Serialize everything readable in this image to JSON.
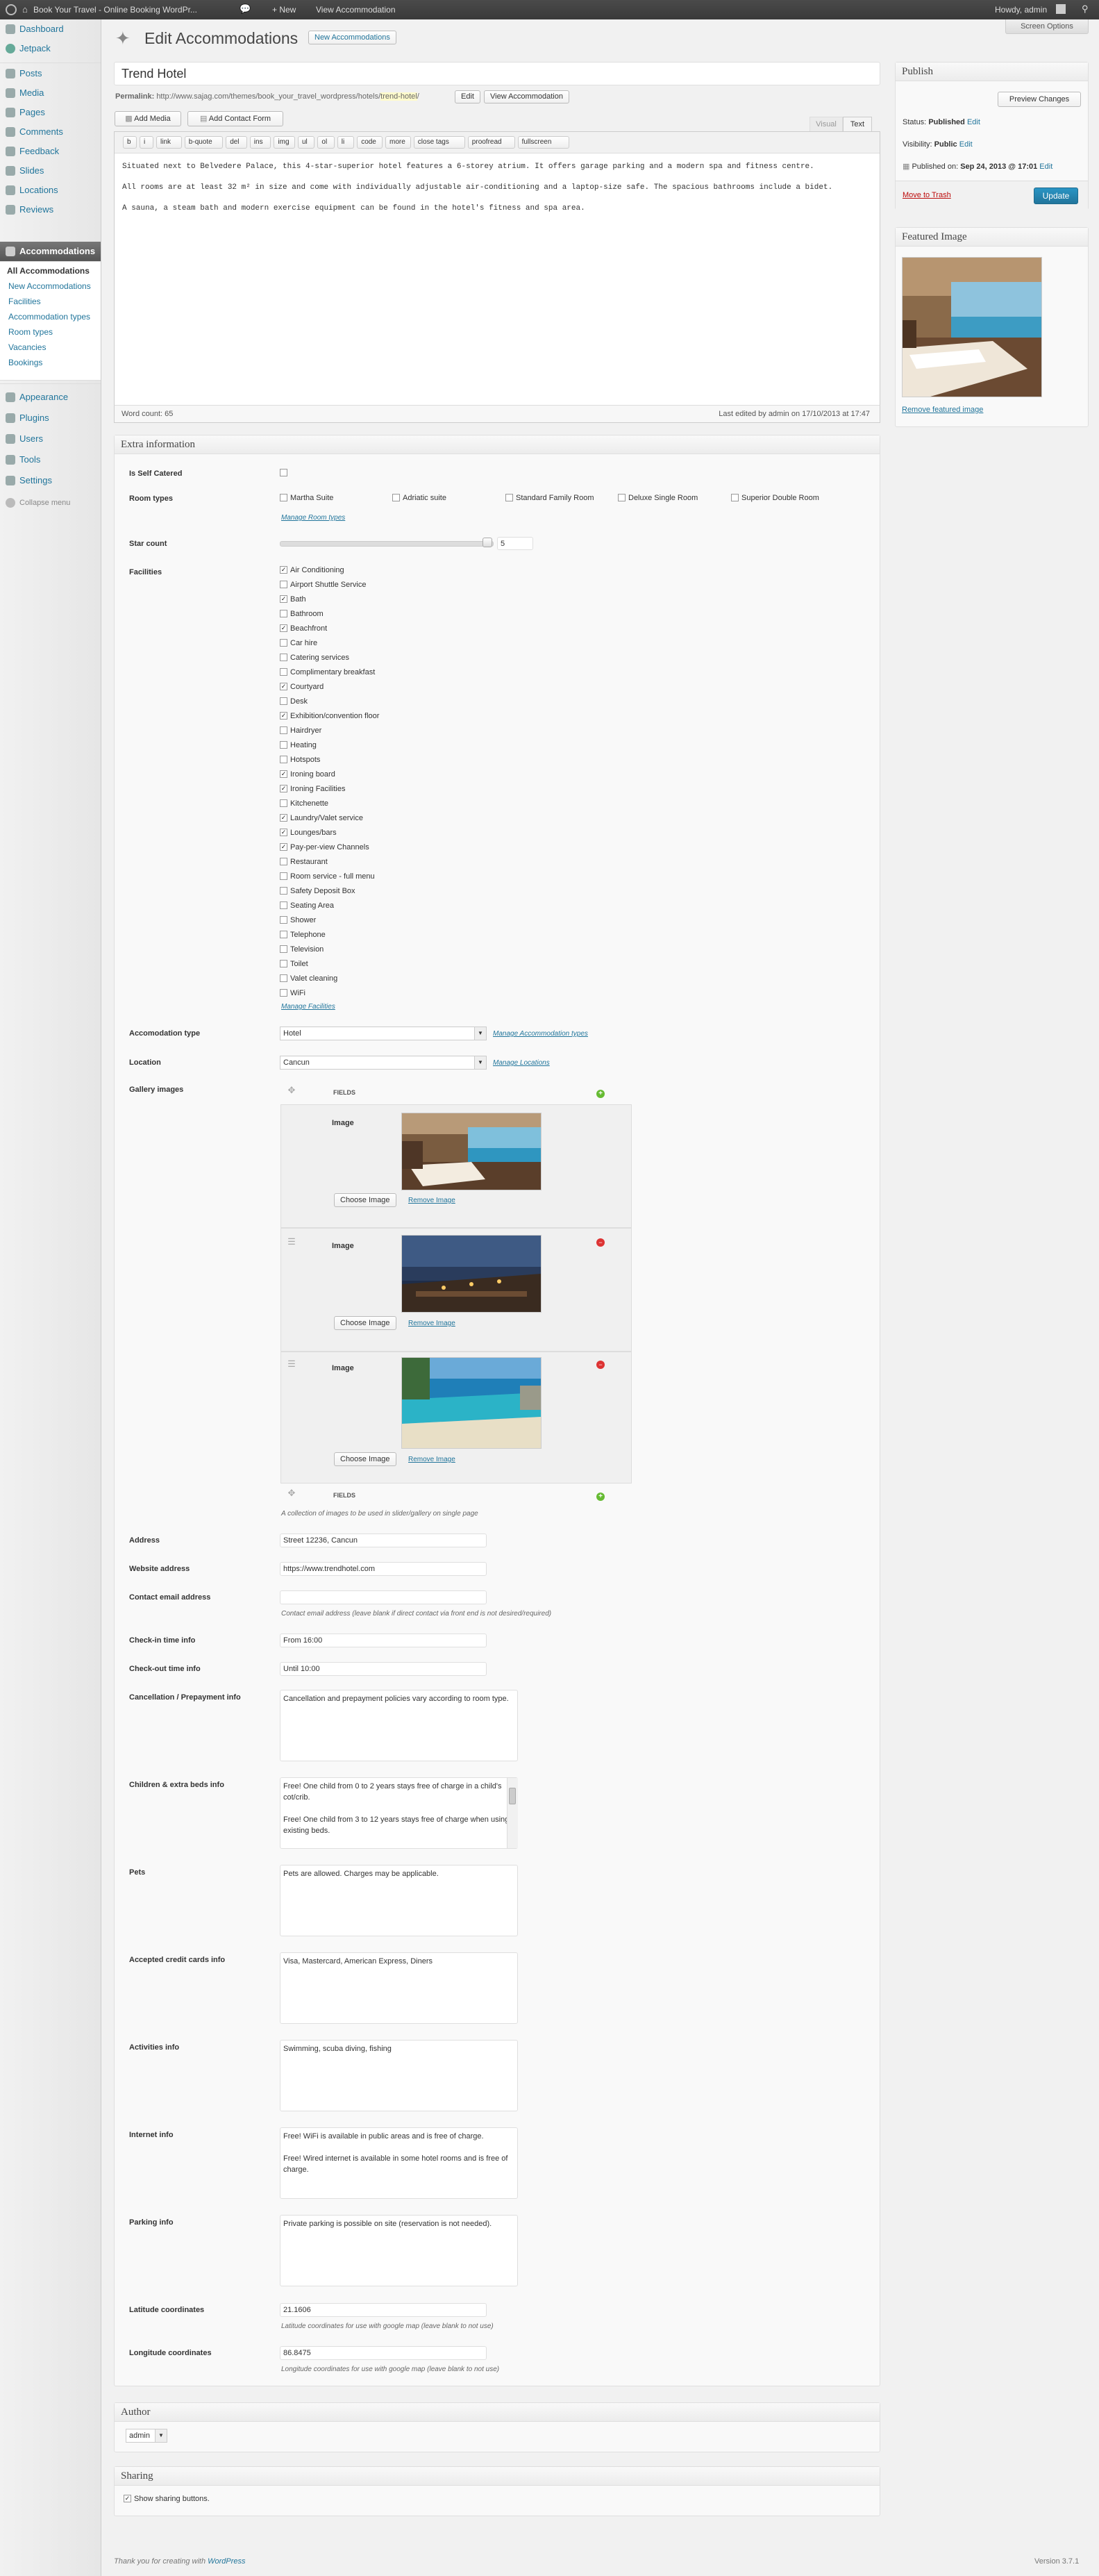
{
  "adminbar": {
    "site_title": "Book Your Travel - Online Booking WordPr...",
    "new_label": "+ New",
    "view_label": "View Accommodation",
    "howdy": "Howdy, admin"
  },
  "sidebar": {
    "items": [
      {
        "label": "Dashboard"
      },
      {
        "label": "Jetpack"
      },
      {
        "label": "Posts"
      },
      {
        "label": "Media"
      },
      {
        "label": "Pages"
      },
      {
        "label": "Comments"
      },
      {
        "label": "Feedback"
      },
      {
        "label": "Slides"
      },
      {
        "label": "Locations"
      },
      {
        "label": "Reviews"
      },
      {
        "label": "Accommodations"
      },
      {
        "label": "Appearance"
      },
      {
        "label": "Plugins"
      },
      {
        "label": "Users"
      },
      {
        "label": "Tools"
      },
      {
        "label": "Settings"
      }
    ],
    "submenu": [
      "All Accommodations",
      "New Accommodations",
      "Facilities",
      "Accommodation types",
      "Room types",
      "Vacancies",
      "Bookings"
    ],
    "collapse": "Collapse menu"
  },
  "header": {
    "title": "Edit Accommodations",
    "new_button": "New Accommodations",
    "screen_options": "Screen Options"
  },
  "editor": {
    "post_title": "Trend Hotel",
    "permalink_label": "Permalink:",
    "permalink_base": "http://www.sajag.com/themes/book_your_travel_wordpress/hotels/",
    "permalink_slug": "trend-hotel",
    "permalink_tail": "/",
    "edit_button": "Edit",
    "view_button": "View Accommodation",
    "add_media": "Add Media",
    "add_contact_form": "Add Contact Form",
    "tab_visual": "Visual",
    "tab_text": "Text",
    "quicktags": [
      "b",
      "i",
      "link",
      "b-quote",
      "del",
      "ins",
      "img",
      "ul",
      "ol",
      "li",
      "code",
      "more",
      "close tags",
      "proofread",
      "fullscreen"
    ],
    "content_lines": [
      "Situated next to Belvedere Palace, this 4-star-superior hotel features a 6-storey atrium. It offers garage parking and a modern spa and fitness centre.",
      "All rooms are at least 32 m² in size and come with individually adjustable air-conditioning and a laptop-size safe. The spacious bathrooms include a bidet.",
      "A sauna, a steam bath and modern exercise equipment can be found in the hotel's fitness and spa area."
    ],
    "word_count": "Word count: 65",
    "last_edited": "Last edited by admin on 17/10/2013 at 17:47"
  },
  "publish": {
    "title": "Publish",
    "preview": "Preview Changes",
    "status_label": "Status:",
    "status_value": "Published",
    "visibility_label": "Visibility:",
    "visibility_value": "Public",
    "published_label": "Published on:",
    "published_value": "Sep 24, 2013 @ 17:01",
    "edit": "Edit",
    "trash": "Move to Trash",
    "update": "Update"
  },
  "featured": {
    "title": "Featured Image",
    "remove": "Remove featured image"
  },
  "extra": {
    "title": "Extra information",
    "self_catered_label": "Is Self Catered",
    "room_types_label": "Room types",
    "room_types": [
      "Martha Suite",
      "Adriatic suite",
      "Standard Family Room",
      "Deluxe Single Room",
      "Superior Double Room"
    ],
    "manage_room_types": "Manage Room types",
    "star_count_label": "Star count",
    "star_count": "5",
    "star_fraction": 1.0,
    "facilities_label": "Facilities",
    "facilities": [
      {
        "name": "Air Conditioning",
        "checked": true
      },
      {
        "name": "Airport Shuttle Service",
        "checked": false
      },
      {
        "name": "Bath",
        "checked": true
      },
      {
        "name": "Bathroom",
        "checked": false
      },
      {
        "name": "Beachfront",
        "checked": true
      },
      {
        "name": "Car hire",
        "checked": false
      },
      {
        "name": "Catering services",
        "checked": false
      },
      {
        "name": "Complimentary breakfast",
        "checked": false
      },
      {
        "name": "Courtyard",
        "checked": true
      },
      {
        "name": "Desk",
        "checked": false
      },
      {
        "name": "Exhibition/convention floor",
        "checked": true
      },
      {
        "name": "Hairdryer",
        "checked": false
      },
      {
        "name": "Heating",
        "checked": false
      },
      {
        "name": "Hotspots",
        "checked": false
      },
      {
        "name": "Ironing board",
        "checked": true
      },
      {
        "name": "Ironing Facilities",
        "checked": true
      },
      {
        "name": "Kitchenette",
        "checked": false
      },
      {
        "name": "Laundry/Valet service",
        "checked": true
      },
      {
        "name": "Lounges/bars",
        "checked": true
      },
      {
        "name": "Pay-per-view Channels",
        "checked": true
      },
      {
        "name": "Restaurant",
        "checked": false
      },
      {
        "name": "Room service - full menu",
        "checked": false
      },
      {
        "name": "Safety Deposit Box",
        "checked": false
      },
      {
        "name": "Seating Area",
        "checked": false
      },
      {
        "name": "Shower",
        "checked": false
      },
      {
        "name": "Telephone",
        "checked": false
      },
      {
        "name": "Television",
        "checked": false
      },
      {
        "name": "Toilet",
        "checked": false
      },
      {
        "name": "Valet cleaning",
        "checked": false
      },
      {
        "name": "WiFi",
        "checked": false
      }
    ],
    "manage_facilities": "Manage Facilities",
    "acc_type_label": "Accomodation type",
    "acc_type_value": "Hotel",
    "manage_acc_types": "Manage Accommodation types",
    "location_label": "Location",
    "location_value": "Cancun",
    "manage_locations": "Manage Locations",
    "gallery_label": "Gallery images",
    "fields_label": "FIELDS",
    "image_label": "Image",
    "choose_image": "Choose Image",
    "remove_image": "Remove Image",
    "gallery_desc": "A collection of images to be used in slider/gallery on single page",
    "address_label": "Address",
    "address_value": "Street 12236, Cancun",
    "website_label": "Website address",
    "website_value": "https://www.trendhotel.com",
    "contact_email_label": "Contact email address",
    "contact_email_value": "",
    "contact_email_desc": "Contact email address (leave blank if direct contact via front end is not desired/required)",
    "checkin_label": "Check-in time info",
    "checkin_value": "From 16:00",
    "checkout_label": "Check-out time info",
    "checkout_value": "Until 10:00",
    "cancellation_label": "Cancellation / Prepayment info",
    "cancellation_value": "Cancellation and prepayment policies vary according to room type.",
    "children_label": "Children & extra beds info",
    "children_value": "Free! One child from 0 to 2 years stays free of charge in a child's cot/crib.\n\nFree! One child from 3 to 12 years stays free of charge when using existing beds.",
    "pets_label": "Pets",
    "pets_value": "Pets are allowed. Charges may be applicable.",
    "cards_label": "Accepted credit cards info",
    "cards_value": "Visa, Mastercard, American Express, Diners",
    "activities_label": "Activities info",
    "activities_value": "Swimming, scuba diving, fishing",
    "internet_label": "Internet info",
    "internet_value": "Free! WiFi is available in public areas and is free of charge.\n\nFree! Wired internet is available in some hotel rooms and is free of charge.",
    "parking_label": "Parking info",
    "parking_value": "Private parking is possible on site (reservation is not needed).",
    "lat_label": "Latitude coordinates",
    "lat_value": "21.1606",
    "lat_desc": "Latitude coordinates for use with google map (leave blank to not use)",
    "lng_label": "Longitude coordinates",
    "lng_value": "86.8475",
    "lng_desc": "Longitude coordinates for use with google map (leave blank to not use)"
  },
  "author": {
    "title": "Author",
    "value": "admin"
  },
  "sharing": {
    "title": "Sharing",
    "checkbox": "Show sharing buttons."
  },
  "footer": {
    "thanks": "Thank you for creating with ",
    "wp": "WordPress",
    "version": "Version 3.7.1"
  }
}
